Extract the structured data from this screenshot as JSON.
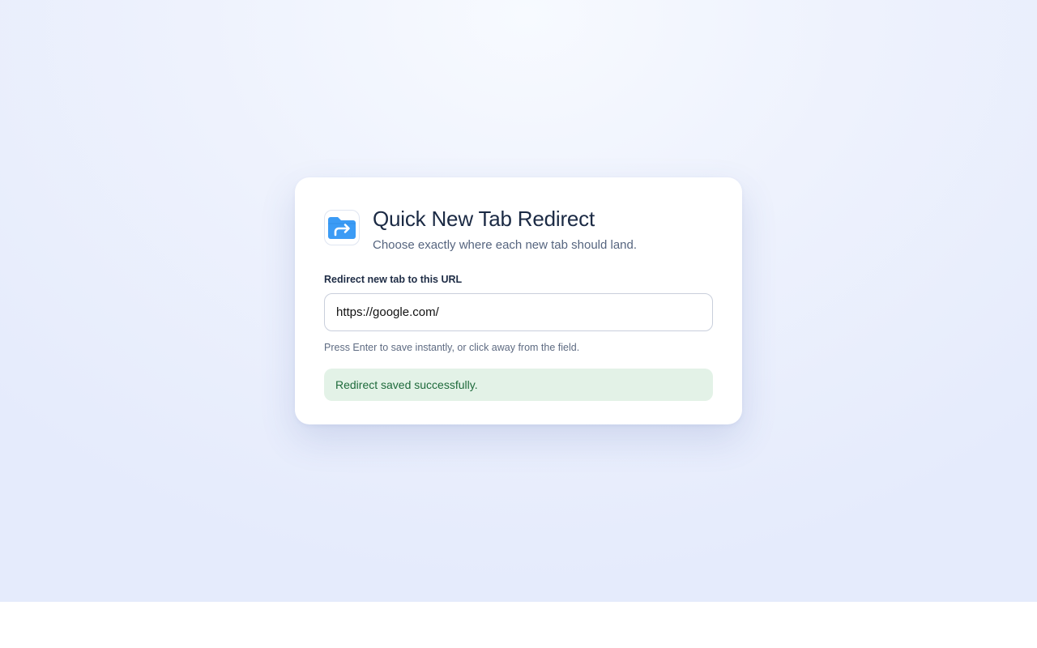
{
  "app": {
    "title": "Quick New Tab Redirect",
    "subtitle": "Choose exactly where each new tab should land.",
    "icon": "folder-redirect-icon"
  },
  "form": {
    "label": "Redirect new tab to this URL",
    "url_value": "https://google.com/",
    "hint": "Press Enter to save instantly, or click away from the field."
  },
  "status": {
    "message": "Redirect saved successfully.",
    "type": "success"
  },
  "colors": {
    "icon_blue": "#3b9bf5",
    "success_bg": "#e3f2e7",
    "success_text": "#1e6a3b",
    "title_text": "#1b2a44"
  }
}
